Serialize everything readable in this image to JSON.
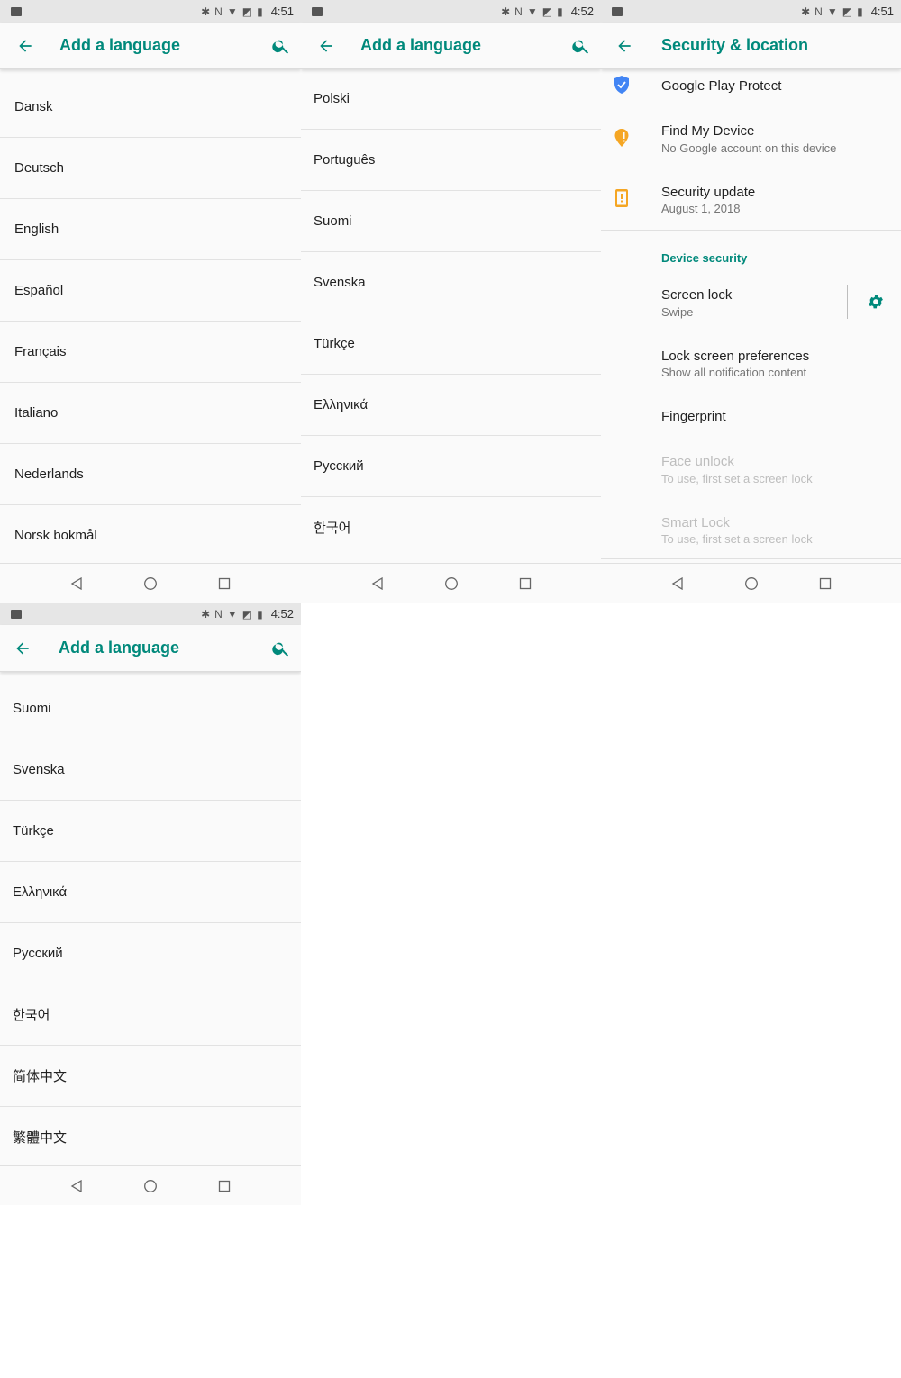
{
  "screen1": {
    "status": {
      "time": "4:51"
    },
    "title": "Add a language",
    "languages": [
      "Dansk",
      "Deutsch",
      "English",
      "Español",
      "Français",
      "Italiano",
      "Nederlands",
      "Norsk bokmål"
    ]
  },
  "screen2": {
    "status": {
      "time": "4:52"
    },
    "title": "Add a language",
    "languages": [
      "Polski",
      "Português",
      "Suomi",
      "Svenska",
      "Türkçe",
      "Ελληνικά",
      "Русский",
      "한국어"
    ]
  },
  "screen3": {
    "status": {
      "time": "4:51"
    },
    "title": "Security & location",
    "items": [
      {
        "title": "Google Play Protect",
        "subtitle": ""
      },
      {
        "title": "Find My Device",
        "subtitle": "No Google account on this device"
      },
      {
        "title": "Security update",
        "subtitle": "August 1, 2018"
      }
    ],
    "section_header": "Device security",
    "device_items": [
      {
        "title": "Screen lock",
        "subtitle": "Swipe"
      },
      {
        "title": "Lock screen preferences",
        "subtitle": "Show all notification content"
      },
      {
        "title": "Fingerprint",
        "subtitle": ""
      },
      {
        "title": "Face unlock",
        "subtitle": "To use, first set a screen lock"
      },
      {
        "title": "Smart Lock",
        "subtitle": "To use, first set a screen lock"
      }
    ]
  },
  "screen4": {
    "status": {
      "time": "4:52"
    },
    "title": "Add a language",
    "languages": [
      "Suomi",
      "Svenska",
      "Türkçe",
      "Ελληνικά",
      "Русский",
      "한국어",
      "简体中文",
      "繁體中文"
    ]
  },
  "colors": {
    "accent": "#00897b",
    "shield": "#4285f4",
    "warning": "#f5a623"
  }
}
